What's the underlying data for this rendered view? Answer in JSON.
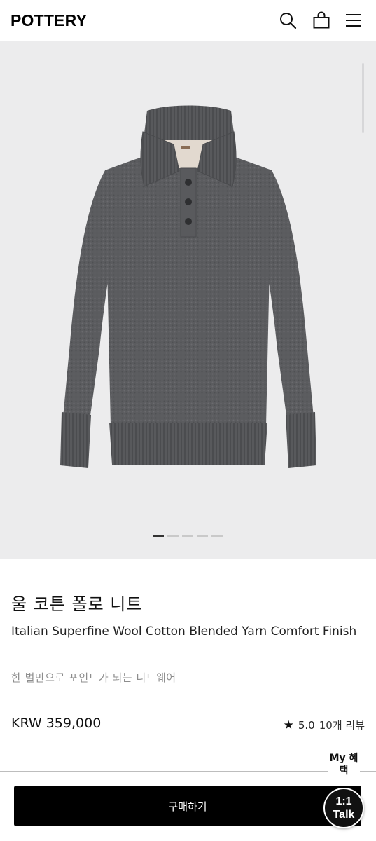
{
  "header": {
    "logo": "POTTERY",
    "icons": [
      "search-icon",
      "shopping-bag-icon",
      "menu-icon"
    ]
  },
  "gallery": {
    "image": "charcoal-grey-knit-polo-sweater",
    "slide_count": 5,
    "active_slide": 1
  },
  "product": {
    "name": "울 코튼 폴로 니트",
    "subtitle": "Italian Superfine Wool Cotton Blended Yarn Comfort Finish",
    "description": "한 벌만으로 포인트가 되는 니트웨어",
    "price": "KRW 359,000",
    "rating": "5.0",
    "reviews": "10개 리뷰"
  },
  "floating": {
    "my_benefit": "My 혜택",
    "talk_line1": "1:1",
    "talk_line2": "Talk"
  },
  "actions": {
    "buy_label": "구매하기"
  },
  "colors": {
    "accent": "#000000",
    "gallery_bg": "#ececed",
    "muted_text": "#8d8d8d"
  }
}
